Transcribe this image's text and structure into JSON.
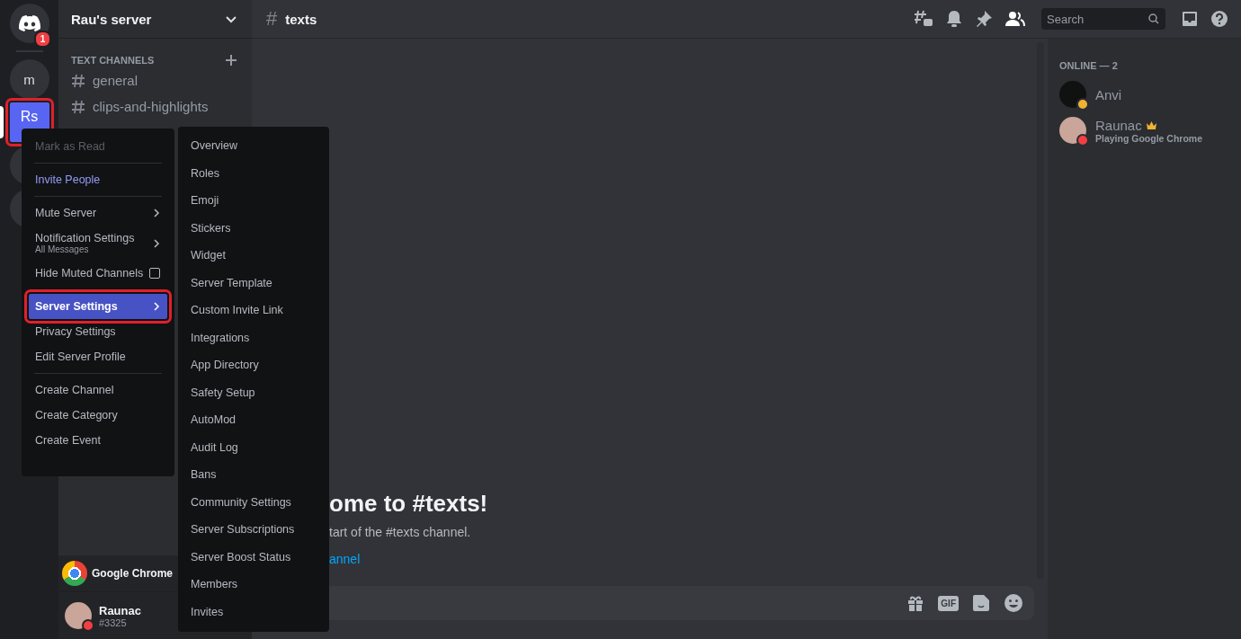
{
  "server_rail": {
    "home_badge": "1",
    "servers": [
      {
        "label": "m",
        "selected": false,
        "highlighted": false
      },
      {
        "label": "Rs",
        "selected": true,
        "highlighted": true
      }
    ]
  },
  "server_header": {
    "title": "Rau's server"
  },
  "channels": {
    "category": "TEXT CHANNELS",
    "items": [
      {
        "name": "general"
      },
      {
        "name": "clips-and-highlights"
      }
    ]
  },
  "activity": {
    "label": "Google Chrome"
  },
  "user_panel": {
    "name": "Raunac",
    "tag": "#3325",
    "color": "#f23f43"
  },
  "channel_header": {
    "hash": "#",
    "name": "texts",
    "search_placeholder": "Search"
  },
  "welcome": {
    "title": "ome to #texts!",
    "subtitle": "tart of the #texts channel.",
    "link": "annel"
  },
  "composer": {
    "gif_label": "GIF"
  },
  "members": {
    "heading": "ONLINE — 2",
    "items": [
      {
        "name": "Anvi",
        "color": "#f0b232",
        "owner": false
      },
      {
        "name": "Raunac",
        "color": "#f23f43",
        "owner": true,
        "activity": "Playing Google Chrome"
      }
    ]
  },
  "context_menu": {
    "groups": [
      [
        {
          "label": "Mark as Read",
          "kind": "plain",
          "disabled": true
        }
      ],
      [
        {
          "label": "Invite People",
          "kind": "accent",
          "disabled": false
        }
      ],
      [
        {
          "label": "Mute Server",
          "kind": "submenu",
          "disabled": false
        },
        {
          "label": "Notification Settings",
          "sublabel": "All Messages",
          "kind": "submenu",
          "disabled": false
        },
        {
          "label": "Hide Muted Channels",
          "kind": "checkbox",
          "checked": false,
          "disabled": false
        }
      ],
      [
        {
          "label": "Server Settings",
          "kind": "submenu",
          "disabled": false,
          "selected": true,
          "highlighted": true
        },
        {
          "label": "Privacy Settings",
          "kind": "plain",
          "disabled": false,
          "selected": false,
          "highlighted": false
        },
        {
          "label": "Edit Server Profile",
          "kind": "plain",
          "disabled": false,
          "selected": false,
          "highlighted": false
        }
      ],
      [
        {
          "label": "Create Channel",
          "kind": "plain",
          "disabled": false
        },
        {
          "label": "Create Category",
          "kind": "plain",
          "disabled": false
        },
        {
          "label": "Create Event",
          "kind": "plain",
          "disabled": false
        }
      ]
    ]
  },
  "submenu": {
    "items": [
      "Overview",
      "Roles",
      "Emoji",
      "Stickers",
      "Widget",
      "Server Template",
      "Custom Invite Link",
      "Integrations",
      "App Directory",
      "Safety Setup",
      "AutoMod",
      "Audit Log",
      "Bans",
      "Community Settings",
      "Server Subscriptions",
      "Server Boost Status",
      "Members",
      "Invites"
    ]
  }
}
